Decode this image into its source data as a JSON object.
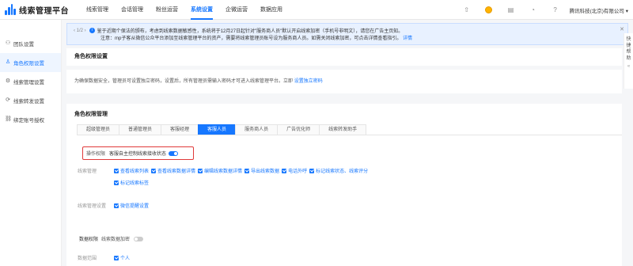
{
  "app": {
    "title": "线索管理平台"
  },
  "nav": [
    "线索管理",
    "会话管理",
    "粉丝运营",
    "系统设置",
    "企微运营",
    "数据应用"
  ],
  "nav_active": 3,
  "header": {
    "company": "腾讯科技(北京)有限公司"
  },
  "sidebar": {
    "items": [
      {
        "label": "团队设置",
        "icon": "team-icon"
      },
      {
        "label": "角色权限设置",
        "icon": "role-icon"
      },
      {
        "label": "线索管理设置",
        "icon": "settings-icon"
      },
      {
        "label": "线索转发设置",
        "icon": "forward-icon"
      },
      {
        "label": "绑定账号授权",
        "icon": "link-icon"
      }
    ],
    "active": 1
  },
  "notice": {
    "pager": "1/2",
    "line1": "鉴于近期个保法的颁布，考虑到线索数据敏感性，系统将于12月27日起针对\"服务商人员\"默认开启线索加密（手机号非明文），请您在广告主页知。",
    "line2_prefix": "注意：mp子客从微信公众平台添加至线索管理平台的资产，需要将线索管理员账号设为服务商人员。如需关闭线索加密，可点击详情查看指引。",
    "line2_link": "详情"
  },
  "rail": {
    "text": "快捷帮助"
  },
  "role_section": {
    "title": "角色权限设置",
    "desc": "为确保数据安全，管理员可设置独立密码，设置后，所有管理员需输入密码才可进入线索管理平台。立即",
    "desc_link": "设置独立密码"
  },
  "perm_card": {
    "title": "角色权限管理",
    "tabs": [
      "超级管理员",
      "普通管理员",
      "客服经理",
      "客服人员",
      "服务商人员",
      "广告优化师",
      "线索转发助手"
    ],
    "active_tab": 3,
    "op_label": "操作权限",
    "op_toggle_label": "客服自主控制线索接收状态",
    "lead_manage_label": "线索管理",
    "lead_manage_items": [
      "查看线索列表",
      "查看线索数据详情",
      "编辑线索数据详情",
      "导出线索数据",
      "电话外呼",
      "标记线索状态、线索评分",
      "标记线索标签"
    ],
    "lead_settings_label": "线索管理设置",
    "lead_settings_items": [
      "微信提醒设置"
    ],
    "data_perm_label": "数据权限",
    "data_encrypt_label": "线索数据加密",
    "data_scope_label": "数据范围",
    "data_scope_items": [
      "个人"
    ]
  }
}
